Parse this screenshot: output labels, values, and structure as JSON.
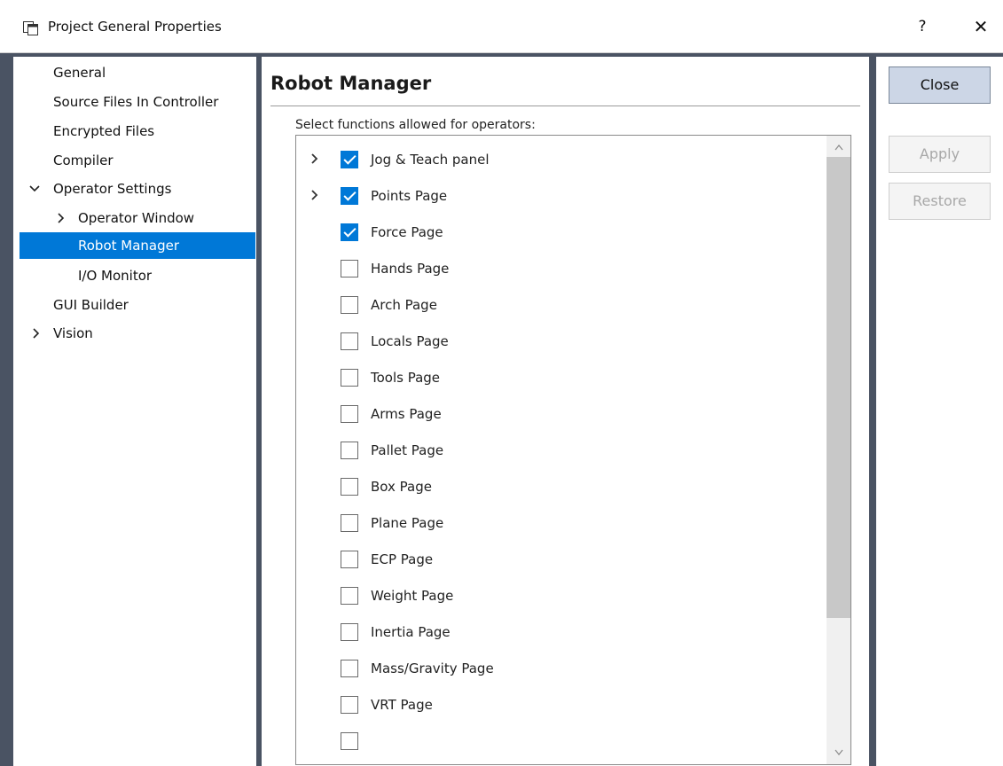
{
  "window": {
    "title": "Project General Properties",
    "help": "?",
    "close": "✕"
  },
  "tree": {
    "items": [
      {
        "label": "General"
      },
      {
        "label": "Source Files In Controller"
      },
      {
        "label": "Encrypted Files"
      },
      {
        "label": "Compiler"
      },
      {
        "label": "Operator Settings"
      },
      {
        "label": "Operator Window"
      },
      {
        "label": "Robot Manager"
      },
      {
        "label": "I/O Monitor"
      },
      {
        "label": "GUI Builder"
      },
      {
        "label": "Vision"
      }
    ],
    "selected": "Robot Manager"
  },
  "main": {
    "section_title": "Robot Manager",
    "list_caption": "Select functions allowed for operators:",
    "items": [
      {
        "label": "Jog & Teach panel",
        "checked": true
      },
      {
        "label": "Points Page",
        "checked": true
      },
      {
        "label": "Force Page",
        "checked": true
      },
      {
        "label": "Hands Page",
        "checked": false
      },
      {
        "label": "Arch Page",
        "checked": false
      },
      {
        "label": "Locals Page",
        "checked": false
      },
      {
        "label": "Tools Page",
        "checked": false
      },
      {
        "label": "Arms Page",
        "checked": false
      },
      {
        "label": "Pallet Page",
        "checked": false
      },
      {
        "label": "Box Page",
        "checked": false
      },
      {
        "label": "Plane Page",
        "checked": false
      },
      {
        "label": "ECP Page",
        "checked": false
      },
      {
        "label": "Weight Page",
        "checked": false
      },
      {
        "label": "Inertia Page",
        "checked": false
      },
      {
        "label": "Mass/Gravity Page",
        "checked": false
      },
      {
        "label": "VRT Page",
        "checked": false
      }
    ]
  },
  "buttons": {
    "close": "Close",
    "apply": "Apply",
    "restore": "Restore"
  },
  "colors": {
    "accent": "#0078d7",
    "frame": "#4a5363",
    "primary_button": "#ccd6e6"
  }
}
